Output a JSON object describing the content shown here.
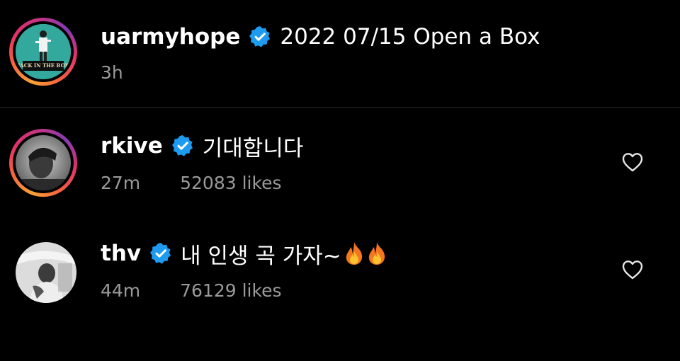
{
  "caption": {
    "username": "uarmyhope",
    "text": "2022 07/15 Open a Box",
    "time": "3h",
    "avatar_text": "JACK IN THE BOX"
  },
  "comments": [
    {
      "username": "rkive",
      "text": "기대합니다",
      "time": "27m",
      "likes": "52083 likes"
    },
    {
      "username": "thv",
      "text": "내 인생 곡 가자~",
      "emoji": "fire-icon fire-icon",
      "time": "44m",
      "likes": "76129 likes"
    }
  ],
  "colors": {
    "background": "#000000",
    "verified_blue": "#1d9bf0",
    "meta_gray": "#9a9a9a",
    "divider": "#262626"
  },
  "icons": [
    "verified-badge-icon",
    "heart-icon",
    "fire-icon"
  ]
}
